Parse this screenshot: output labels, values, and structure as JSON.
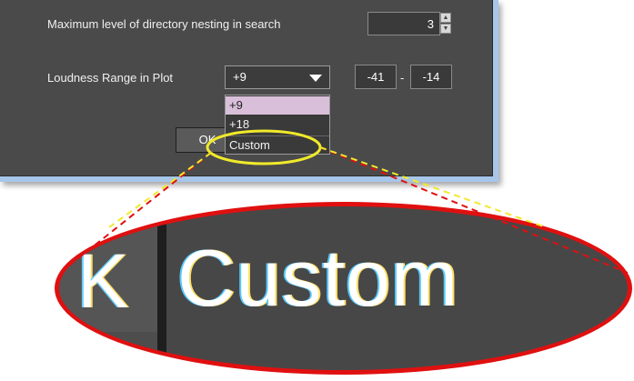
{
  "settings": {
    "nesting_label": "Maximum level of directory nesting in search",
    "nesting_value": "3",
    "loudness_label": "Loudness Range in Plot",
    "loudness_selected": "+9",
    "range_min": "-41",
    "range_separator": "-",
    "range_max": "-14"
  },
  "dropdown": {
    "options": [
      "+9",
      "+18",
      "Custom"
    ]
  },
  "buttons": {
    "ok_label": "OK"
  },
  "zoom": {
    "partial_char": "K",
    "text": "Custom"
  },
  "colors": {
    "dialog_bg": "#4a4a4a",
    "highlight_option": "#d9bfd9",
    "ellipse_yellow": "#f0ea2a",
    "callout_red": "#e01010"
  },
  "icons": [
    "spinner-up-icon",
    "spinner-down-icon",
    "dropdown-arrow-icon"
  ]
}
